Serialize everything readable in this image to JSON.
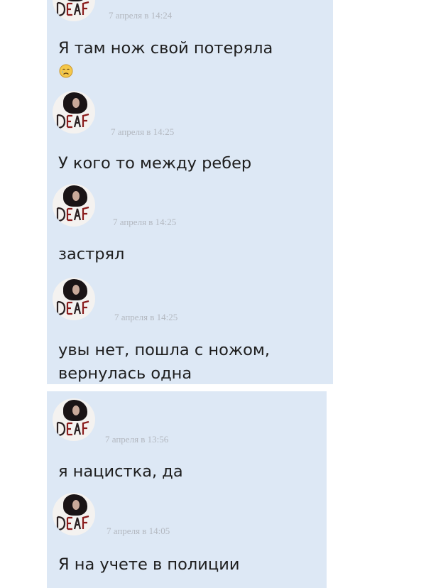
{
  "messages_top": [
    {
      "timestamp": "7 апреля в 14:24",
      "lines": [
        "Я там нож свой потеряла"
      ],
      "emoji": "crying-face-icon"
    },
    {
      "timestamp": "7 апреля в 14:25",
      "lines": [
        "У кого то между ребер"
      ]
    },
    {
      "timestamp": "7 апреля в 14:25",
      "lines": [
        "застрял"
      ]
    },
    {
      "timestamp": "7 апреля в 14:25",
      "lines": [
        "увы нет, пошла с ножом,",
        "вернулась одна"
      ]
    }
  ],
  "messages_bottom": [
    {
      "timestamp": "7 апреля в 13:56",
      "lines": [
        "я нацистка, да"
      ]
    },
    {
      "timestamp": "7 апреля в 14:05",
      "lines": [
        "Я на учете в полиции"
      ]
    }
  ],
  "avatar": {
    "icon": "user-avatar-icon",
    "logo_text": "DEAF"
  },
  "colors": {
    "panel": "#dde8f5",
    "text": "#1e1e1e",
    "timestamp": "#b3b8c0",
    "background": "#ffffff"
  }
}
